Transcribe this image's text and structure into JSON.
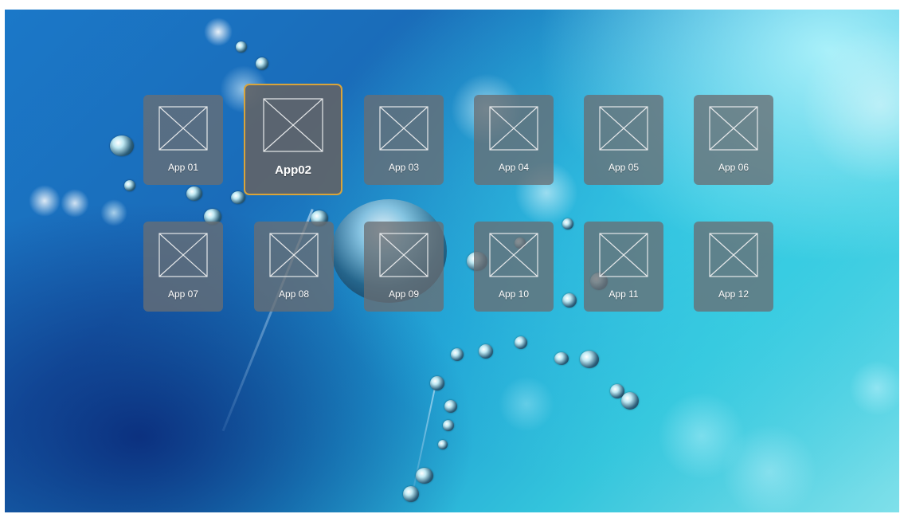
{
  "apps": [
    {
      "label": "App 01",
      "icon": "placeholder-image-icon",
      "focused": false
    },
    {
      "label": "App02",
      "icon": "placeholder-image-icon",
      "focused": true
    },
    {
      "label": "App 03",
      "icon": "placeholder-image-icon",
      "focused": false
    },
    {
      "label": "App 04",
      "icon": "placeholder-image-icon",
      "focused": false
    },
    {
      "label": "App 05",
      "icon": "placeholder-image-icon",
      "focused": false
    },
    {
      "label": "App 06",
      "icon": "placeholder-image-icon",
      "focused": false
    },
    {
      "label": "App 07",
      "icon": "placeholder-image-icon",
      "focused": false
    },
    {
      "label": "App 08",
      "icon": "placeholder-image-icon",
      "focused": false
    },
    {
      "label": "App 09",
      "icon": "placeholder-image-icon",
      "focused": false
    },
    {
      "label": "App 10",
      "icon": "placeholder-image-icon",
      "focused": false
    },
    {
      "label": "App 11",
      "icon": "placeholder-image-icon",
      "focused": false
    },
    {
      "label": "App 12",
      "icon": "placeholder-image-icon",
      "focused": false
    }
  ],
  "colors": {
    "focus_border": "#d9a43a",
    "tile_background": "#696e73"
  }
}
